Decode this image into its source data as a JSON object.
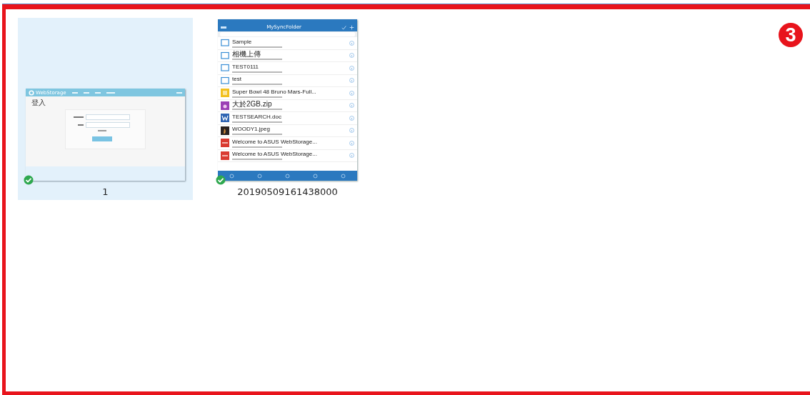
{
  "step_badge": "3",
  "files": [
    {
      "name": "1",
      "selected": true,
      "synced": true,
      "thumbnail": {
        "kind": "web-login",
        "brand": "WebStorage",
        "heading": "登入"
      }
    },
    {
      "name": "20190509161438000",
      "selected": false,
      "synced": true,
      "thumbnail": {
        "kind": "phone-list",
        "title": "MySyncFolder",
        "rows": [
          {
            "name": "Sample",
            "kind": "folder"
          },
          {
            "name": "相機上傳",
            "kind": "folder"
          },
          {
            "name": "TEST0111",
            "kind": "folder"
          },
          {
            "name": "test",
            "kind": "folder"
          },
          {
            "name": "Super Bowl 48 Bruno Mars-Full...",
            "kind": "audio"
          },
          {
            "name": "大於2GB.zip",
            "kind": "zip"
          },
          {
            "name": "TESTSEARCH.doc",
            "kind": "doc"
          },
          {
            "name": "WOODY1.jpeg",
            "kind": "image"
          },
          {
            "name": "Welcome to ASUS WebStorage...",
            "kind": "pdf"
          },
          {
            "name": "Welcome to ASUS WebStorage...",
            "kind": "pdf"
          }
        ]
      }
    }
  ]
}
